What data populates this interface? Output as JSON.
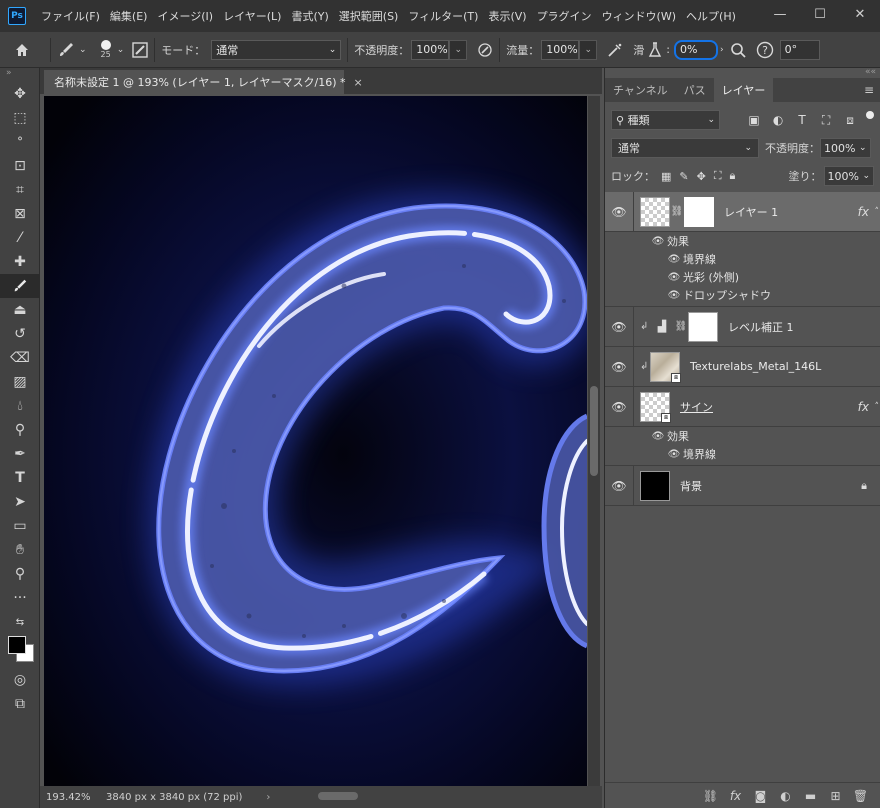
{
  "app": {
    "logo": "Ps",
    "menu": [
      "ファイル(F)",
      "編集(E)",
      "イメージ(I)",
      "レイヤー(L)",
      "書式(Y)",
      "選択範囲(S)",
      "フィルター(T)",
      "表示(V)",
      "プラグイン",
      "ウィンドウ(W)",
      "ヘルプ(H)"
    ],
    "window_controls": {
      "minimize": "—",
      "maximize": "☐",
      "close": "✕"
    }
  },
  "options": {
    "brush_size": "25",
    "mode_label": "モード：",
    "mode_value": "通常",
    "opacity_label": "不透明度：",
    "opacity_value": "100%",
    "flow_label": "流量：",
    "flow_value": "100%",
    "smoothing_label": "滑",
    "smoothing_value": "0%",
    "angle_value": "0°",
    "highlight_color": "#1473e6"
  },
  "document": {
    "tab_title": "名称未設定 1 @ 193% (レイヤー 1, レイヤーマスク/16) *",
    "close": "×",
    "zoom": "193.42%",
    "info": "3840 px x 3840 px (72 ppi)",
    "status_arrow": "›",
    "neon_color": "#5d7bff",
    "neon_core": "#f2f4ff"
  },
  "panel": {
    "tabs": [
      "チャンネル",
      "パス",
      "レイヤー"
    ],
    "active_tab": 2,
    "filter_label": "種類",
    "blend_mode": "通常",
    "opacity_label": "不透明度：",
    "opacity_value": "100%",
    "lock_label": "ロック：",
    "fill_label": "塗り：",
    "fill_value": "100%",
    "layers": {
      "layer1": {
        "name": "レイヤー 1",
        "fx": "fx",
        "effects_label": "効果",
        "effects": [
          "境界線",
          "光彩 (外側)",
          "ドロップシャドウ"
        ]
      },
      "levels": {
        "name": "レベル補正 1"
      },
      "texture": {
        "name": "Texturelabs_Metal_146L"
      },
      "sign": {
        "name": "サイン",
        "fx": "fx",
        "effects_label": "効果",
        "effects": [
          "境界線"
        ]
      },
      "background": {
        "name": "背景"
      }
    }
  }
}
